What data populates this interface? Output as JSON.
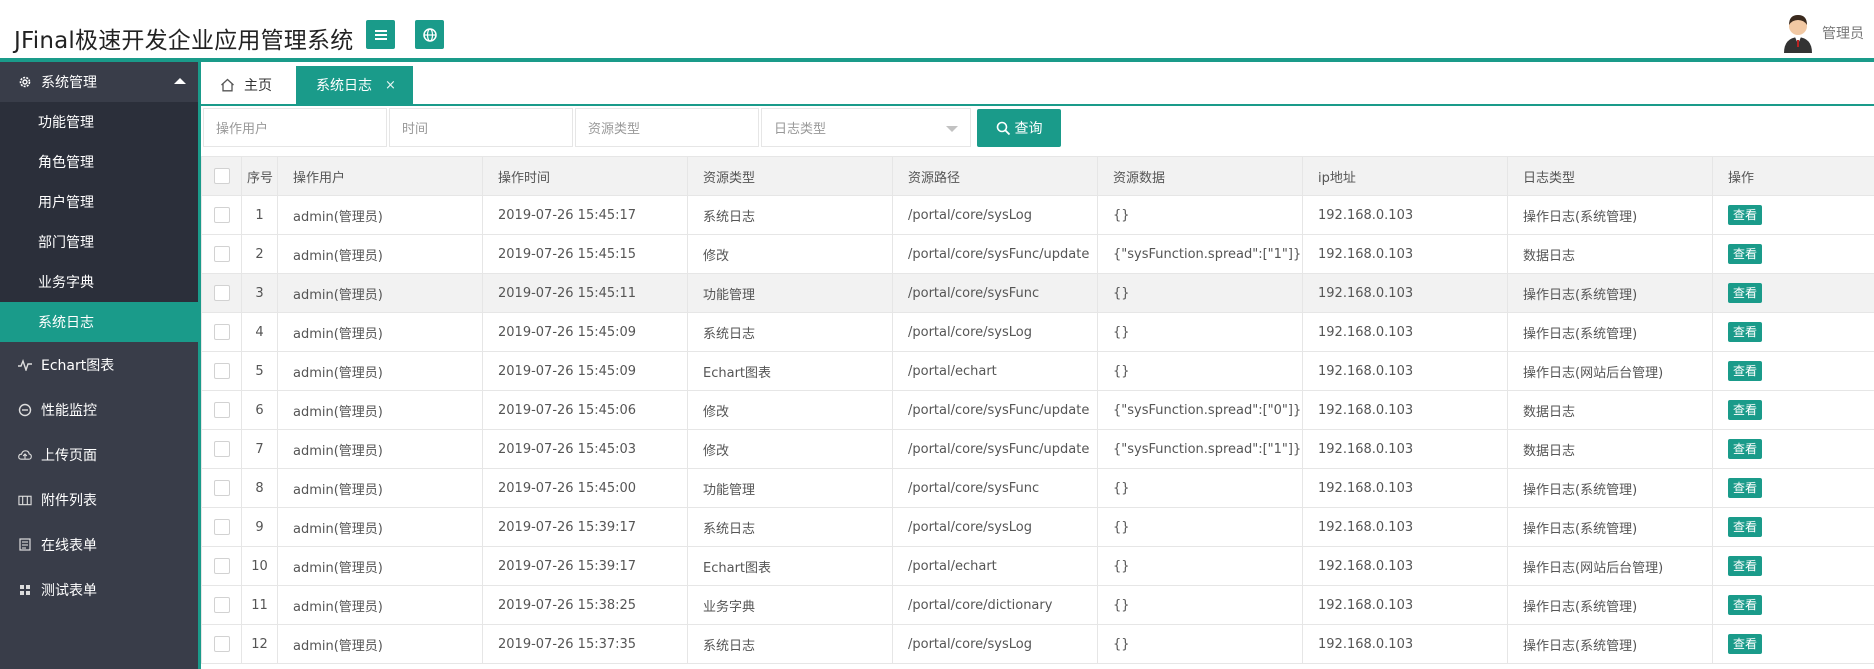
{
  "header": {
    "title": "JFinal极速开发企业应用管理系统",
    "user_name": "管理员",
    "accent": "#1a9b8a"
  },
  "sidebar": {
    "group": {
      "label": "系统管理",
      "icon": "gear-icon",
      "expanded": true
    },
    "sub_items": [
      {
        "label": "功能管理",
        "active": false
      },
      {
        "label": "角色管理",
        "active": false
      },
      {
        "label": "用户管理",
        "active": false
      },
      {
        "label": "部门管理",
        "active": false
      },
      {
        "label": "业务字典",
        "active": false
      },
      {
        "label": "系统日志",
        "active": true
      }
    ],
    "items": [
      {
        "label": "Echart图表",
        "icon": "pulse-icon"
      },
      {
        "label": "性能监控",
        "icon": "monitor-icon"
      },
      {
        "label": "上传页面",
        "icon": "upload-cloud-icon"
      },
      {
        "label": "附件列表",
        "icon": "attachment-list-icon"
      },
      {
        "label": "在线表单",
        "icon": "form-icon"
      },
      {
        "label": "测试表单",
        "icon": "grid-icon"
      }
    ]
  },
  "tabs": {
    "home": "主页",
    "active": "系统日志",
    "close": "×"
  },
  "search": {
    "user_placeholder": "操作用户",
    "time_placeholder": "时间",
    "resource_type_placeholder": "资源类型",
    "log_type_selected": "日志类型",
    "query_label": "查询"
  },
  "table": {
    "columns": [
      "序号",
      "操作用户",
      "操作时间",
      "资源类型",
      "资源路径",
      "资源数据",
      "ip地址",
      "日志类型",
      "操作"
    ],
    "action_label": "查看",
    "rows": [
      {
        "no": "1",
        "user": "admin(管理员)",
        "time": "2019-07-26 15:45:17",
        "type": "系统日志",
        "path": "/portal/core/sysLog",
        "data": "{}",
        "ip": "192.168.0.103",
        "log_type": "操作日志(系统管理)"
      },
      {
        "no": "2",
        "user": "admin(管理员)",
        "time": "2019-07-26 15:45:15",
        "type": "修改",
        "path": "/portal/core/sysFunc/update",
        "data": "{\"sysFunction.spread\":[\"1\"]}",
        "ip": "192.168.0.103",
        "log_type": "数据日志"
      },
      {
        "no": "3",
        "user": "admin(管理员)",
        "time": "2019-07-26 15:45:11",
        "type": "功能管理",
        "path": "/portal/core/sysFunc",
        "data": "{}",
        "ip": "192.168.0.103",
        "log_type": "操作日志(系统管理)"
      },
      {
        "no": "4",
        "user": "admin(管理员)",
        "time": "2019-07-26 15:45:09",
        "type": "系统日志",
        "path": "/portal/core/sysLog",
        "data": "{}",
        "ip": "192.168.0.103",
        "log_type": "操作日志(系统管理)"
      },
      {
        "no": "5",
        "user": "admin(管理员)",
        "time": "2019-07-26 15:45:09",
        "type": "Echart图表",
        "path": "/portal/echart",
        "data": "{}",
        "ip": "192.168.0.103",
        "log_type": "操作日志(网站后台管理)"
      },
      {
        "no": "6",
        "user": "admin(管理员)",
        "time": "2019-07-26 15:45:06",
        "type": "修改",
        "path": "/portal/core/sysFunc/update",
        "data": "{\"sysFunction.spread\":[\"0\"]}",
        "ip": "192.168.0.103",
        "log_type": "数据日志"
      },
      {
        "no": "7",
        "user": "admin(管理员)",
        "time": "2019-07-26 15:45:03",
        "type": "修改",
        "path": "/portal/core/sysFunc/update",
        "data": "{\"sysFunction.spread\":[\"1\"]}",
        "ip": "192.168.0.103",
        "log_type": "数据日志"
      },
      {
        "no": "8",
        "user": "admin(管理员)",
        "time": "2019-07-26 15:45:00",
        "type": "功能管理",
        "path": "/portal/core/sysFunc",
        "data": "{}",
        "ip": "192.168.0.103",
        "log_type": "操作日志(系统管理)"
      },
      {
        "no": "9",
        "user": "admin(管理员)",
        "time": "2019-07-26 15:39:17",
        "type": "系统日志",
        "path": "/portal/core/sysLog",
        "data": "{}",
        "ip": "192.168.0.103",
        "log_type": "操作日志(系统管理)"
      },
      {
        "no": "10",
        "user": "admin(管理员)",
        "time": "2019-07-26 15:39:17",
        "type": "Echart图表",
        "path": "/portal/echart",
        "data": "{}",
        "ip": "192.168.0.103",
        "log_type": "操作日志(网站后台管理)"
      },
      {
        "no": "11",
        "user": "admin(管理员)",
        "time": "2019-07-26 15:38:25",
        "type": "业务字典",
        "path": "/portal/core/dictionary",
        "data": "{}",
        "ip": "192.168.0.103",
        "log_type": "操作日志(系统管理)"
      },
      {
        "no": "12",
        "user": "admin(管理员)",
        "time": "2019-07-26 15:37:35",
        "type": "系统日志",
        "path": "/portal/core/sysLog",
        "data": "{}",
        "ip": "192.168.0.103",
        "log_type": "操作日志(系统管理)"
      }
    ]
  }
}
